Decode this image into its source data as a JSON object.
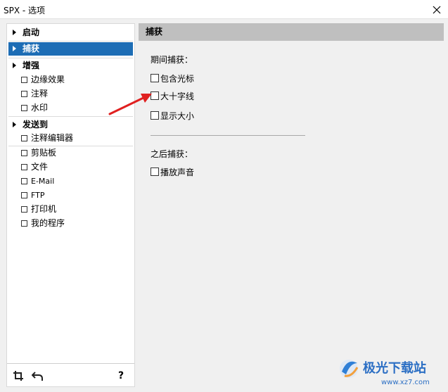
{
  "window": {
    "title": "SPX - 选项"
  },
  "sidebar": {
    "headers": [
      {
        "label": "启动",
        "selected": false
      },
      {
        "label": "捕获",
        "selected": true
      },
      {
        "label": "增强",
        "selected": false
      },
      {
        "label": "发送到",
        "selected": false
      }
    ],
    "enhance_items": [
      "边缘效果",
      "注释",
      "水印"
    ],
    "send_items": [
      "注释编辑器",
      "剪贴板",
      "文件",
      "E-Mail",
      "FTP",
      "打印机",
      "我的程序"
    ],
    "help_label": "?"
  },
  "panel": {
    "title": "捕获",
    "during_label": "期间捕获：",
    "during_options": [
      "包含光标",
      "大十字线",
      "显示大小"
    ],
    "after_label": "之后捕获：",
    "after_options": [
      "播放声音"
    ]
  },
  "colors": {
    "selected_bg": "#1d6db5",
    "header_bg": "#bfbfbf",
    "annotation_arrow": "#e02020"
  },
  "icons": [
    "close-icon",
    "crop-icon",
    "undo-icon",
    "help-icon"
  ],
  "watermark": {
    "site": "极光下载站",
    "url": "www.xz7.com"
  }
}
